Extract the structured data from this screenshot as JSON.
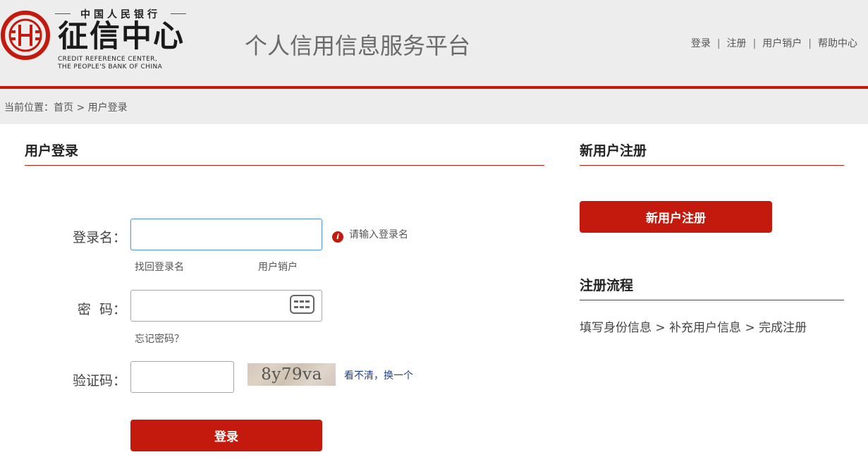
{
  "header": {
    "logo": {
      "top_text": "中国人民银行",
      "name": "征信中心",
      "en_line1": "CREDIT REFERENCE  CENTER,",
      "en_line2": "THE PEOPLE'S BANK OF CHINA"
    },
    "platform_title": "个人信用信息服务平台",
    "nav": [
      "登录",
      "注册",
      "用户销户",
      "帮助中心"
    ],
    "nav_separator": "|"
  },
  "breadcrumb": {
    "prefix": "当前位置：",
    "home": "首页",
    "separator": " > ",
    "current": "用户登录"
  },
  "login": {
    "title": "用户登录",
    "username_label": "登录名：",
    "username_value": "",
    "username_hint": "请输入登录名",
    "retrieve_username": "找回登录名",
    "cancel_account": "用户销户",
    "password_label": "密  码：",
    "password_value": "",
    "forgot_password": "忘记密码？",
    "captcha_label": "验证码：",
    "captcha_value": "",
    "captcha_text": "8y79va",
    "captcha_refresh": "看不清，换一个",
    "submit": "登录"
  },
  "register": {
    "title": "新用户注册",
    "button": "新用户注册",
    "process_title": "注册流程",
    "process_text": "填写身份信息 > 补充用户信息 > 完成注册"
  },
  "colors": {
    "brand_red": "#c4190d",
    "header_bg": "#ededed",
    "link_blue": "#1e3f8f"
  }
}
